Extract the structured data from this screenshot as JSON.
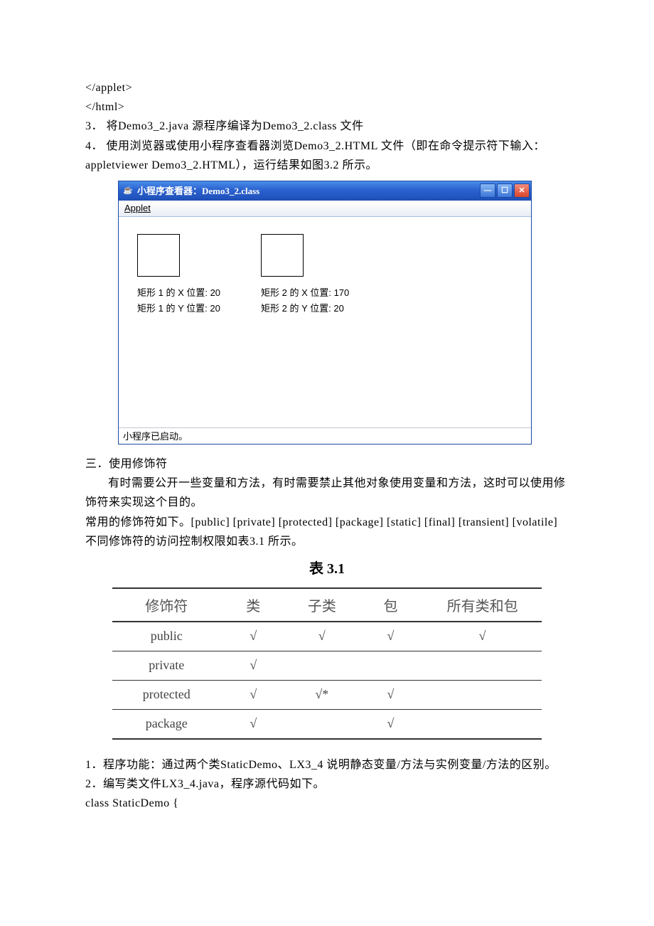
{
  "lines": {
    "l1": "</applet>",
    "l2": "</html>",
    "l3": "3． 将Demo3_2.java 源程序编译为Demo3_2.class 文件",
    "l4": "4． 使用浏览器或使用小程序查看器浏览Demo3_2.HTML 文件（即在命令提示符下输入：",
    "l5": "appletviewer Demo3_2.HTML），运行结果如图3.2 所示。"
  },
  "applet": {
    "title": "小程序查看器：Demo3_2.class",
    "menu_applet": "Applet",
    "rect1_x": "矩形 1 的 X 位置: 20",
    "rect1_y": "矩形 1 的 Y 位置: 20",
    "rect2_x": "矩形 2 的 X 位置: 170",
    "rect2_y": "矩形 2 的 Y 位置: 20",
    "status": "小程序已启动。",
    "btn_min": "—",
    "btn_max": "☐",
    "btn_close": "✕"
  },
  "section3": {
    "title": "三．使用修饰符",
    "p1": "有时需要公开一些变量和方法，有时需要禁止其他对象使用变量和方法，这时可以使用修饰符来实现这个目的。",
    "p2": "常用的修饰符如下。[public] [private] [protected] [package] [static] [final] [transient] [volatile]不同修饰符的访问控制权限如表3.1 所示。"
  },
  "table": {
    "caption": "表 3.1",
    "headers": [
      "修饰符",
      "类",
      "子类",
      "包",
      "所有类和包"
    ],
    "rows": [
      [
        "public",
        "√",
        "√",
        "√",
        "√"
      ],
      [
        "private",
        "√",
        "",
        "",
        ""
      ],
      [
        "protected",
        "√",
        "√*",
        "√",
        ""
      ],
      [
        "package",
        "√",
        "",
        "√",
        ""
      ]
    ]
  },
  "footer": {
    "l1": "1．程序功能：通过两个类StaticDemo、LX3_4 说明静态变量/方法与实例变量/方法的区别。",
    "l2": "2．编写类文件LX3_4.java，程序源代码如下。",
    "l3": "class StaticDemo {"
  }
}
